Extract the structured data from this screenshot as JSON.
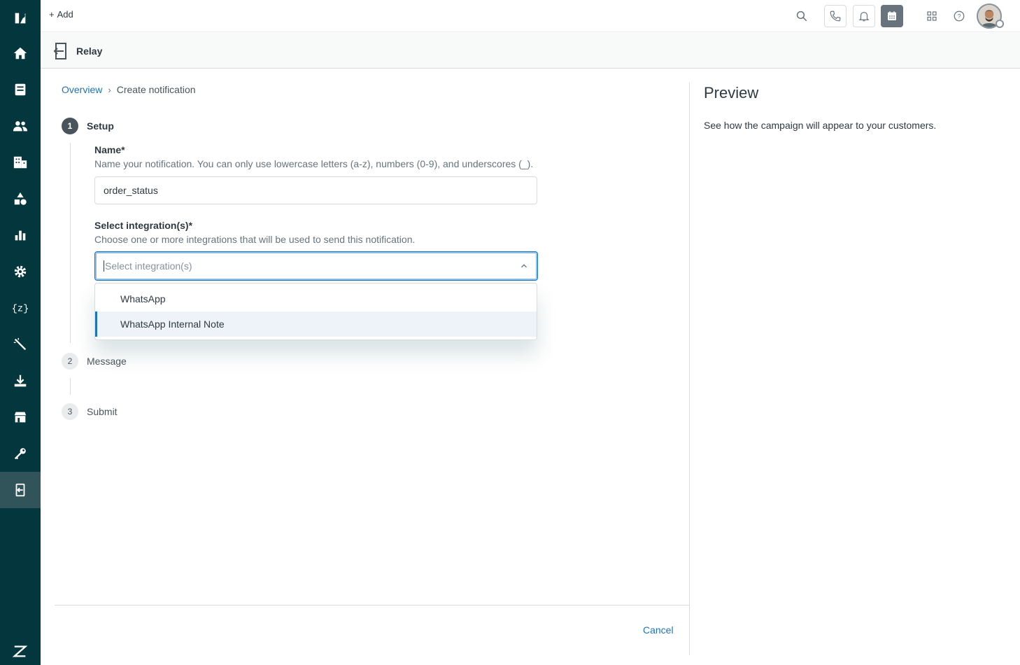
{
  "topbar": {
    "add_label": "Add"
  },
  "app": {
    "name": "Relay"
  },
  "breadcrumb": {
    "overview": "Overview",
    "separator": "›",
    "current": "Create notification"
  },
  "steps": [
    {
      "number": "1",
      "label": "Setup",
      "active": true
    },
    {
      "number": "2",
      "label": "Message",
      "active": false
    },
    {
      "number": "3",
      "label": "Submit",
      "active": false
    }
  ],
  "form": {
    "name": {
      "label": "Name*",
      "hint": "Name your notification. You can only use lowercase letters (a-z), numbers (0-9), and underscores (_).",
      "value": "order_status"
    },
    "integration": {
      "label": "Select integration(s)*",
      "hint": "Choose one or more integrations that will be used to send this notification.",
      "placeholder": "Select integration(s)",
      "options": [
        "WhatsApp",
        "WhatsApp Internal Note"
      ]
    }
  },
  "footer": {
    "cancel_label": "Cancel"
  },
  "preview": {
    "title": "Preview",
    "description": "See how the campaign will appear to your customers."
  },
  "nav_icons": [
    "zendesk-logo-icon",
    "home-icon",
    "views-icon",
    "customers-icon",
    "organizations-icon",
    "objects-icon",
    "reporting-icon",
    "settings-icon",
    "zis-icon",
    "magic-wand-icon",
    "download-icon",
    "store-icon",
    "key-icon",
    "relay-app-icon",
    "zendesk-icon"
  ],
  "colors": {
    "nav_bg": "#03363d",
    "accent": "#1f73b7"
  }
}
